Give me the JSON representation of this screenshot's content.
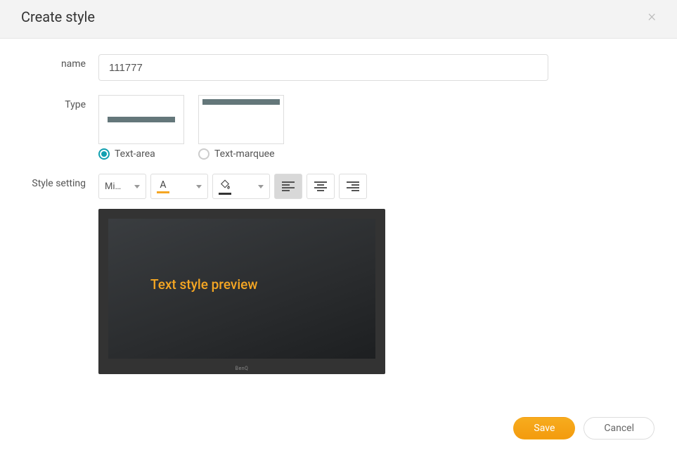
{
  "modal": {
    "title": "Create style",
    "close": "×"
  },
  "form": {
    "name_label": "name",
    "name_value": "111777",
    "type_label": "Type",
    "type_options": {
      "text_area": "Text-area",
      "text_marquee": "Text-marquee",
      "selected": "text_area"
    },
    "style_label": "Style setting",
    "font": {
      "selected": "Mi…"
    },
    "text_color": {
      "indicator": "A",
      "hex": "#f5a623"
    },
    "fill_color": {
      "hex": "#333333"
    },
    "alignment": {
      "selected": "left"
    }
  },
  "preview": {
    "text": "Text style preview",
    "text_color": "#f5a623",
    "brand": "BenQ"
  },
  "actions": {
    "save": "Save",
    "cancel": "Cancel"
  }
}
